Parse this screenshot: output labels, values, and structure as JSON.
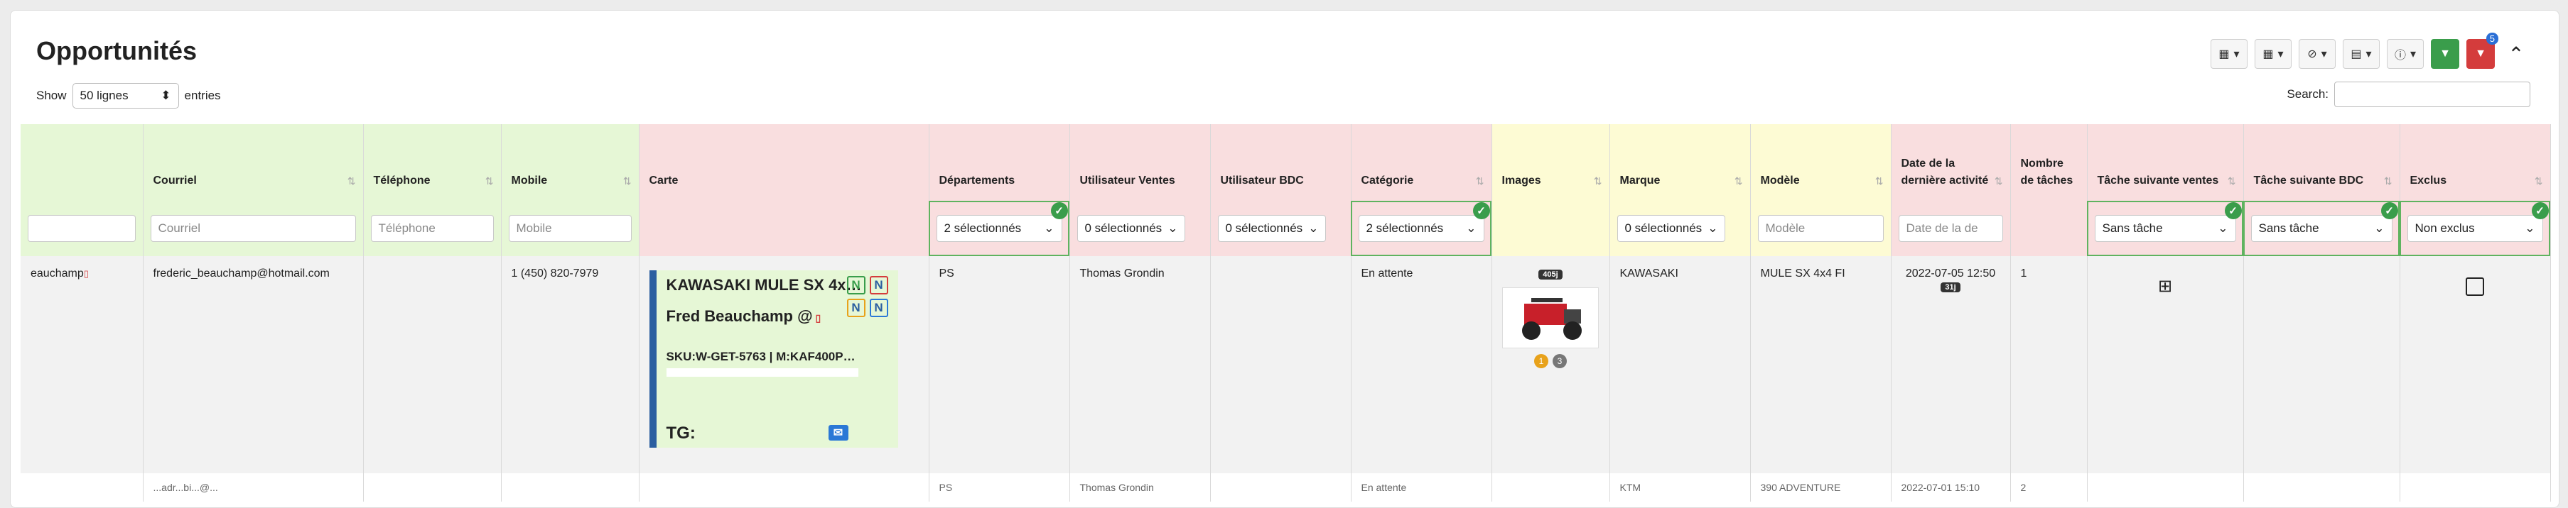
{
  "header": {
    "title": "Opportunités",
    "toolbar": {
      "filter_badge": "5"
    }
  },
  "list": {
    "show_label": "Show",
    "page_size": "50 lignes",
    "entries_label": "entries",
    "search_label": "Search:"
  },
  "columns": [
    {
      "label": ""
    },
    {
      "label": "Courriel"
    },
    {
      "label": "Téléphone"
    },
    {
      "label": "Mobile"
    },
    {
      "label": "Carte"
    },
    {
      "label": "Départements"
    },
    {
      "label": "Utilisateur Ventes"
    },
    {
      "label": "Utilisateur BDC"
    },
    {
      "label": "Catégorie"
    },
    {
      "label": "Images"
    },
    {
      "label": "Marque"
    },
    {
      "label": "Modèle"
    },
    {
      "label": "Date de la dernière activité"
    },
    {
      "label": "Nombre de tâches"
    },
    {
      "label": "Tâche suivante ventes"
    },
    {
      "label": "Tâche suivante BDC"
    },
    {
      "label": "Exclus"
    }
  ],
  "filters": {
    "courriel": "Courriel",
    "telephone": "Téléphone",
    "mobile": "Mobile",
    "departements": "2 sélectionnés",
    "utilisateur_ventes": "0 sélectionnés",
    "utilisateur_bdc": "0 sélectionnés",
    "categorie": "2 sélectionnés",
    "marque": "0 sélectionnés",
    "modele": "Modèle",
    "date": "Date de la de",
    "tache_ventes": "Sans tâche",
    "tache_bdc": "Sans tâche",
    "exclus": "Non exclus"
  },
  "row": {
    "name_fragment": "eauchamp",
    "courriel": "frederic_beauchamp@hotmail.com",
    "mobile": "1 (450) 820-7979",
    "carte": {
      "line1": "KAWASAKI MULE SX 4x…",
      "line2": "Fred Beauchamp @",
      "line3": "SKU:W-GET-5763 | M:KAF400P…",
      "line4": "TG:"
    },
    "departement": "PS",
    "utilisateur_ventes": "Thomas Grondin",
    "categorie": "En attente",
    "image_badge": "405j",
    "image_dot1": "1",
    "image_dot2": "3",
    "marque": "KAWASAKI",
    "modele": "MULE SX 4x4 FI",
    "date": "2022-07-05 12:50",
    "date_badge": "31j",
    "nb_taches": "1"
  },
  "next_row": {
    "courriel": "...adr...bi...@...",
    "departement": "PS",
    "utilisateur": "Thomas Grondin",
    "categorie": "En attente",
    "marque": "KTM",
    "modele": "390 ADVENTURE",
    "date": "2022-07-01 15:10",
    "nb": "2"
  },
  "colors": {
    "green": "#3a9d4b",
    "red": "#d43c3c",
    "blue": "#2b6fd6"
  }
}
